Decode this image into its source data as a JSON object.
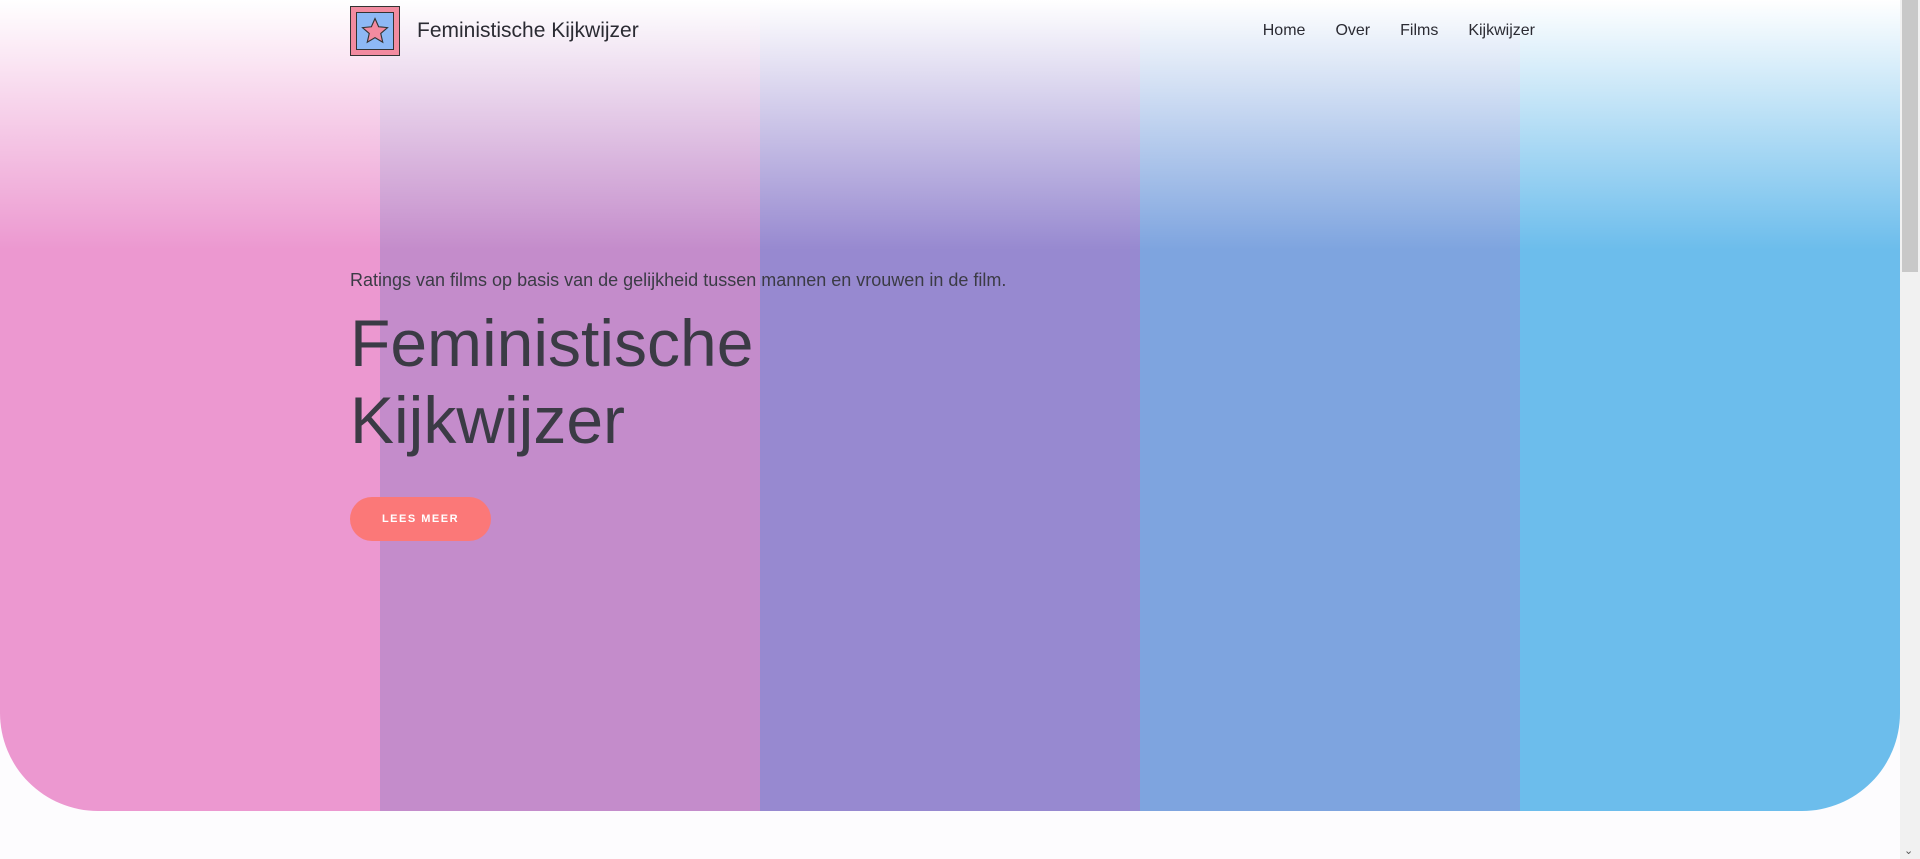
{
  "colors": {
    "stripes": [
      "#ec98d0",
      "#c48ccb",
      "#9789d0",
      "#7ea4df",
      "#6cbdec"
    ],
    "button": "#fb7878"
  },
  "header": {
    "site_title": "Feministische Kijkwijzer",
    "logo_icon": "star-icon",
    "nav": [
      "Home",
      "Over",
      "Films",
      "Kijkwijzer"
    ]
  },
  "hero": {
    "subtitle": "Ratings van films op basis van de gelijkheid tussen mannen en vrouwen in de film.",
    "title_line1": "Feministische",
    "title_line2": "Kijkwijzer",
    "button": "LEES MEER"
  }
}
